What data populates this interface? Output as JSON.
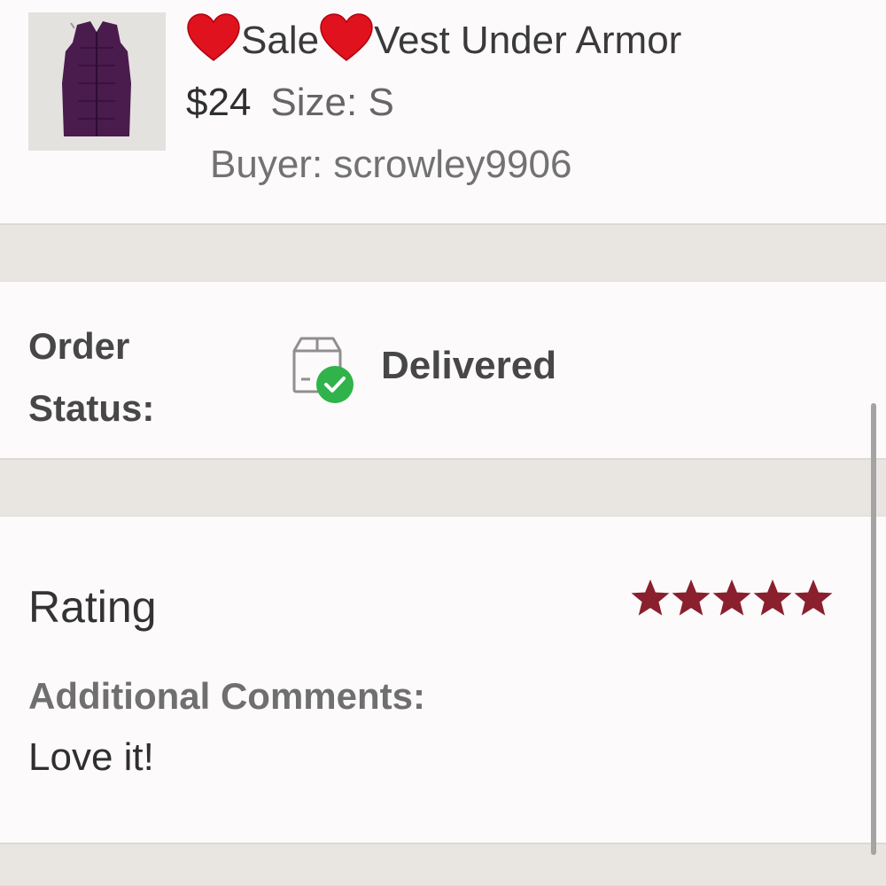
{
  "listing": {
    "title_sale": "Sale",
    "title_item": "Vest Under Armor",
    "price": "$24",
    "size": "Size: S",
    "buyer": "Buyer: scrowley9906",
    "thumbnail_icon": "purple-vest-photo",
    "heart_icon": "red-heart-emoji",
    "heart_color": "#e0121e"
  },
  "order_status": {
    "label": "Order Status:",
    "value": "Delivered",
    "icon": "package-delivered-icon",
    "check_color": "#2fb34a"
  },
  "rating": {
    "label": "Rating",
    "stars": 5,
    "max_stars": 5,
    "star_color": "#8a1f2e",
    "comments_label": "Additional Comments:",
    "comment": "Love it!"
  }
}
